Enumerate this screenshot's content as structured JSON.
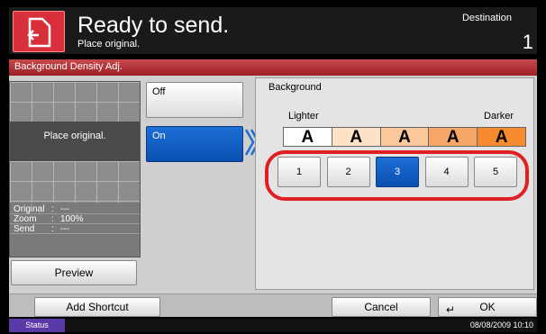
{
  "header": {
    "title": "Ready to send.",
    "subtitle": "Place original.",
    "destination_label": "Destination",
    "destination_count": "1"
  },
  "panel": {
    "title": "Background Density Adj."
  },
  "preview": {
    "message": "Place original.",
    "info": [
      {
        "key": "Original",
        "sep": ":",
        "value": "---"
      },
      {
        "key": "Zoom",
        "sep": ":",
        "value": "100%"
      },
      {
        "key": "Send",
        "sep": ":",
        "value": "---"
      }
    ],
    "button_label": "Preview"
  },
  "options": {
    "off_label": "Off",
    "on_label": "On",
    "selected": "On"
  },
  "background": {
    "title": "Background",
    "lighter": "Lighter",
    "darker": "Darker",
    "samples": [
      "A",
      "A",
      "A",
      "A",
      "A"
    ],
    "sample_colors": [
      "#ffffff",
      "#fde2c8",
      "#fcc79a",
      "#f9a766",
      "#f58a2e"
    ],
    "levels": [
      "1",
      "2",
      "3",
      "4",
      "5"
    ],
    "selected_level": "3"
  },
  "bottom": {
    "shortcut_label": "Add Shortcut",
    "cancel_label": "Cancel",
    "ok_label": "OK"
  },
  "status": {
    "label": "Status",
    "datetime": "08/08/2009   10:10"
  }
}
